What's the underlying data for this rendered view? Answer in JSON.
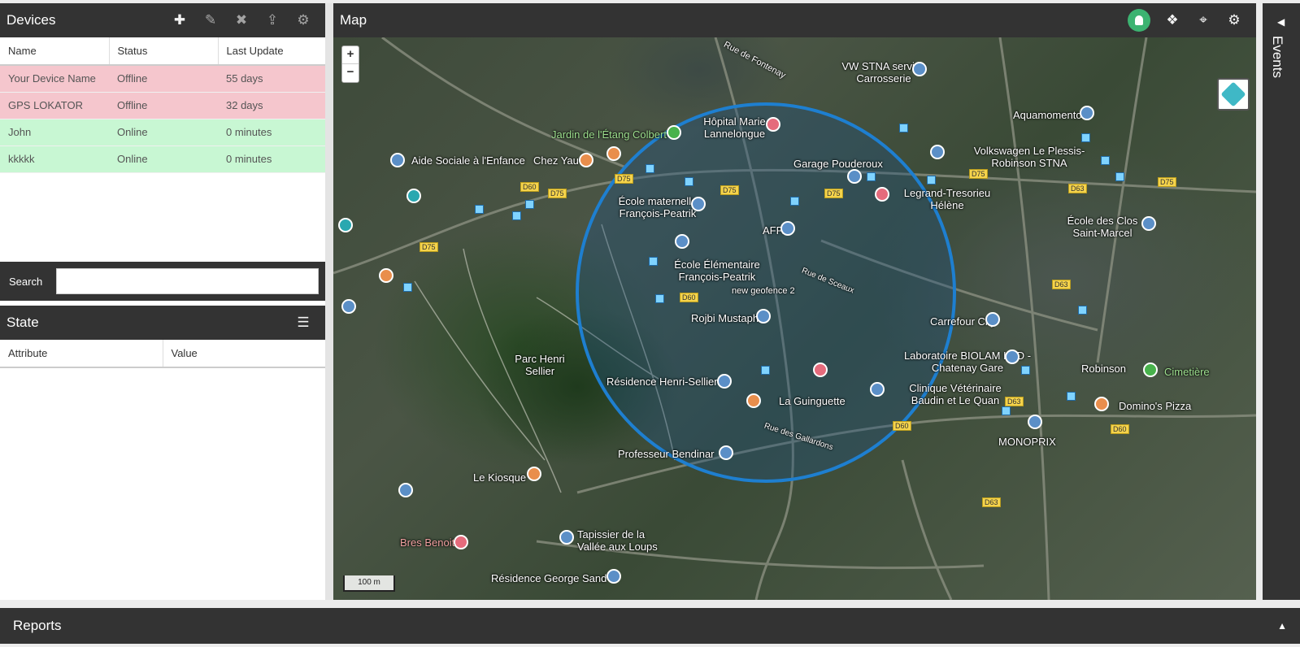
{
  "devices": {
    "title": "Devices",
    "columns": [
      "Name",
      "Status",
      "Last Update"
    ],
    "rows": [
      {
        "name": "Your Device Name",
        "status": "Offline",
        "last_update": "55 days",
        "state": "offline"
      },
      {
        "name": "GPS LOKATOR",
        "status": "Offline",
        "last_update": "32 days",
        "state": "offline"
      },
      {
        "name": "John",
        "status": "Online",
        "last_update": "0 minutes",
        "state": "online"
      },
      {
        "name": "kkkkk",
        "status": "Online",
        "last_update": "0 minutes",
        "state": "online"
      }
    ],
    "toolbar_icons": [
      "plus-icon",
      "edit-icon",
      "remove-icon",
      "upload-icon",
      "gear-icon"
    ]
  },
  "search": {
    "label": "Search",
    "value": ""
  },
  "state": {
    "title": "State",
    "columns": [
      "Attribute",
      "Value"
    ]
  },
  "map": {
    "title": "Map",
    "zoom_in": "+",
    "zoom_out": "−",
    "scale": "100 m",
    "geofence_label": "new geofence 2",
    "labels": [
      "Jardin de l'Étang Colbert",
      "Hôpital Marie Lannelongue",
      "Garage Pouderoux",
      "VW STNA service Carrosserie",
      "Aquamomento",
      "Volkswagen Le Plessis-Robinson STNA",
      "Legrand-Tresorieu Hélène",
      "École maternelle François-Peatrik",
      "AFPA",
      "École Élémentaire François-Peatrik",
      "Rojbi Mustapha",
      "Résidence Henri-Sellier",
      "La Guinguette",
      "Professeur Bendinar",
      "Le Kiosque",
      "Parc Henri Sellier",
      "Tapissier de la Vallée aux Loups",
      "Résidence George Sand",
      "Bres Benoit",
      "Carrefour City",
      "Laboratoire BIOLAM LCD - Chatenay Gare",
      "Clinique Vétérinaire Baudin et Le Quan",
      "MONOPRIX",
      "Robinson",
      "Cimetière",
      "Domino's Pizza",
      "École des Clos Saint-Marcel",
      "Aide Sociale à l'Enfance",
      "Chez Yau",
      "Rue de Fontenay",
      "Rue de Sceaux",
      "Rue des Gallardons"
    ]
  },
  "events": {
    "title": "Events"
  },
  "reports": {
    "title": "Reports"
  }
}
